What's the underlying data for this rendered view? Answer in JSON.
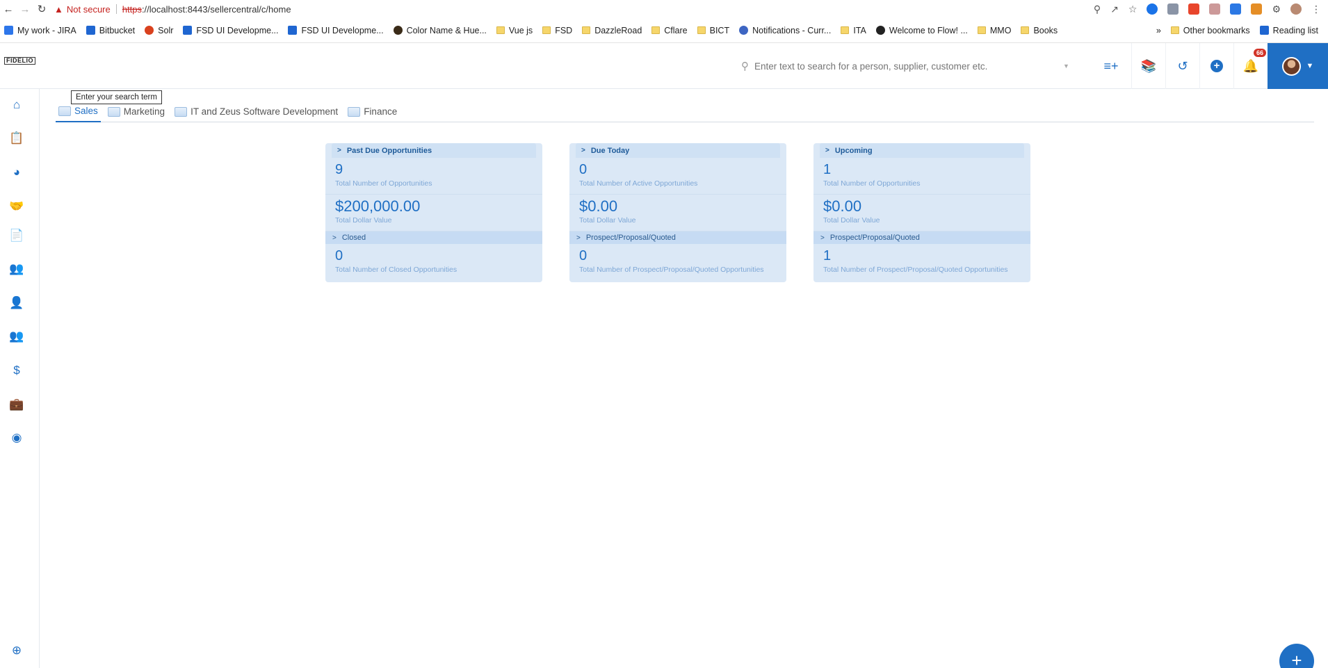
{
  "browser": {
    "not_secure": "Not secure",
    "url_scheme": "https",
    "url_rest": "://localhost:8443/sellercentral/c/home",
    "bookmarks": [
      {
        "label": "My work - JIRA",
        "icon": "jira"
      },
      {
        "label": "Bitbucket",
        "icon": "blue"
      },
      {
        "label": "Solr",
        "icon": "solr"
      },
      {
        "label": "FSD UI Developme...",
        "icon": "blue"
      },
      {
        "label": "FSD UI Developme...",
        "icon": "blue"
      },
      {
        "label": "Color Name & Hue...",
        "icon": "dark"
      },
      {
        "label": "Vue js",
        "icon": "folder"
      },
      {
        "label": "FSD",
        "icon": "folder"
      },
      {
        "label": "DazzleRoad",
        "icon": "folder"
      },
      {
        "label": "Cflare",
        "icon": "folder"
      },
      {
        "label": "BICT",
        "icon": "folder"
      },
      {
        "label": "Notifications - Curr...",
        "icon": "notif"
      },
      {
        "label": "ITA",
        "icon": "folder"
      },
      {
        "label": "Welcome to Flow! ...",
        "icon": "flow"
      },
      {
        "label": "MMO",
        "icon": "folder"
      },
      {
        "label": "Books",
        "icon": "folder"
      }
    ],
    "more": "»",
    "other_bookmarks": "Other bookmarks",
    "reading_list": "Reading list"
  },
  "header": {
    "logo_text": "FIDELIO",
    "search_placeholder": "Enter text to search for a person, supplier, customer etc.",
    "notification_count": "66"
  },
  "tooltip": "Enter your search term",
  "tabs": [
    {
      "label": "Sales",
      "active": true
    },
    {
      "label": "Marketing",
      "active": false
    },
    {
      "label": "IT and Zeus Software Development",
      "active": false
    },
    {
      "label": "Finance",
      "active": false
    }
  ],
  "cards": [
    {
      "title": "Past Due Opportunities",
      "count": "9",
      "count_label": "Total Number of Opportunities",
      "amount": "$200,000.00",
      "amount_label": "Total Dollar Value",
      "sub_title": "Closed",
      "sub_count": "0",
      "sub_label": "Total Number of Closed Opportunities"
    },
    {
      "title": "Due Today",
      "count": "0",
      "count_label": "Total Number of Active Opportunities",
      "amount": "$0.00",
      "amount_label": "Total Dollar Value",
      "sub_title": "Prospect/Proposal/Quoted",
      "sub_count": "0",
      "sub_label": "Total Number of Prospect/Proposal/Quoted Opportunities"
    },
    {
      "title": "Upcoming",
      "count": "1",
      "count_label": "Total Number of Opportunities",
      "amount": "$0.00",
      "amount_label": "Total Dollar Value",
      "sub_title": "Prospect/Proposal/Quoted",
      "sub_count": "1",
      "sub_label": "Total Number of Prospect/Proposal/Quoted Opportunities"
    }
  ],
  "colors": {
    "accent": "#1f6fc4",
    "card_bg": "#dbe8f6",
    "badge": "#d23327"
  }
}
